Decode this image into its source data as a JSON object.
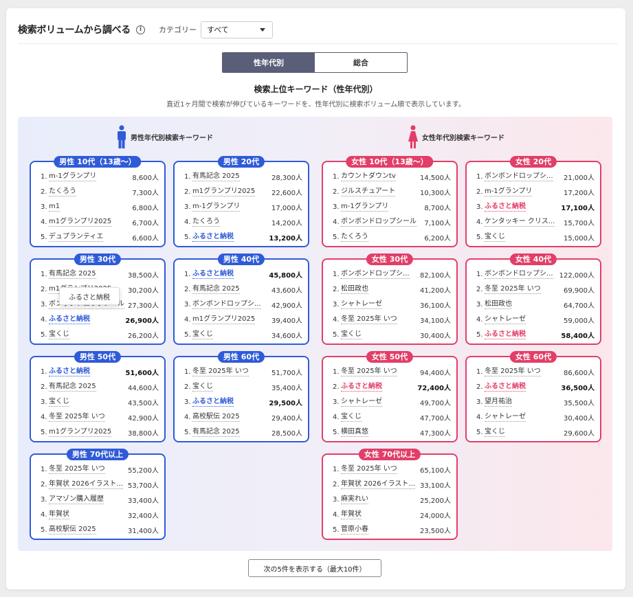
{
  "header": {
    "title": "検索ボリュームから調べる",
    "info_icon": "info-icon",
    "category_label": "カテゴリー",
    "category_value": "すべて"
  },
  "toggle": {
    "left": "性年代別",
    "right": "総合",
    "active": "left"
  },
  "section": {
    "title": "検索上位キーワード（性年代別）",
    "description": "直近1ヶ月間で検索が伸びているキーワードを、性年代別に検索ボリューム順で表示しています。"
  },
  "male_heading": "男性年代別検索キーワード",
  "female_heading": "女性年代別検索キーワード",
  "colors": {
    "male": "#2f5bd8",
    "female": "#e23e68",
    "toggle_active": "#5a5e78"
  },
  "groups": [
    {
      "gender": "m",
      "label": "男性 10代（13歳〜）",
      "items": [
        {
          "rank": "1.",
          "kw": "m-1グランプリ",
          "vol": "8,600人",
          "hl": false
        },
        {
          "rank": "2.",
          "kw": "たくろう",
          "vol": "7,300人",
          "hl": false
        },
        {
          "rank": "3.",
          "kw": "m1",
          "vol": "6,800人",
          "hl": false
        },
        {
          "rank": "4.",
          "kw": "m1グランプリ2025",
          "vol": "6,700人",
          "hl": false
        },
        {
          "rank": "5.",
          "kw": "デュプランティエ",
          "vol": "6,600人",
          "hl": false
        }
      ]
    },
    {
      "gender": "m",
      "label": "男性 20代",
      "items": [
        {
          "rank": "1.",
          "kw": "有馬記念 2025",
          "vol": "28,300人",
          "hl": false
        },
        {
          "rank": "2.",
          "kw": "m1グランプリ2025",
          "vol": "22,600人",
          "hl": false
        },
        {
          "rank": "3.",
          "kw": "m-1グランプリ",
          "vol": "17,000人",
          "hl": false
        },
        {
          "rank": "4.",
          "kw": "たくろう",
          "vol": "14,200人",
          "hl": false
        },
        {
          "rank": "5.",
          "kw": "ふるさと納税",
          "vol": "13,200人",
          "hl": true
        }
      ]
    },
    {
      "gender": "m",
      "label": "男性 30代",
      "items": [
        {
          "rank": "1.",
          "kw": "有馬記念 2025",
          "vol": "38,500人",
          "hl": false
        },
        {
          "rank": "2.",
          "kw": "m1グランプリ2025",
          "vol": "30,200人",
          "hl": false
        },
        {
          "rank": "3.",
          "kw": "ボンボンドロップシール",
          "vol": "27,300人",
          "hl": false
        },
        {
          "rank": "4.",
          "kw": "ふるさと納税",
          "vol": "26,900人",
          "hl": true
        },
        {
          "rank": "5.",
          "kw": "宝くじ",
          "vol": "26,200人",
          "hl": false
        }
      ]
    },
    {
      "gender": "m",
      "label": "男性 40代",
      "items": [
        {
          "rank": "1.",
          "kw": "ふるさと納税",
          "vol": "45,800人",
          "hl": true
        },
        {
          "rank": "2.",
          "kw": "有馬記念 2025",
          "vol": "43,600人",
          "hl": false
        },
        {
          "rank": "3.",
          "kw": "ボンボンドロップシ...",
          "vol": "42,900人",
          "hl": false
        },
        {
          "rank": "4.",
          "kw": "m1グランプリ2025",
          "vol": "39,400人",
          "hl": false
        },
        {
          "rank": "5.",
          "kw": "宝くじ",
          "vol": "34,600人",
          "hl": false
        }
      ]
    },
    {
      "gender": "m",
      "label": "男性 50代",
      "items": [
        {
          "rank": "1.",
          "kw": "ふるさと納税",
          "vol": "51,600人",
          "hl": true
        },
        {
          "rank": "2.",
          "kw": "有馬記念 2025",
          "vol": "44,600人",
          "hl": false
        },
        {
          "rank": "3.",
          "kw": "宝くじ",
          "vol": "43,500人",
          "hl": false
        },
        {
          "rank": "4.",
          "kw": "冬至 2025年 いつ",
          "vol": "42,900人",
          "hl": false
        },
        {
          "rank": "5.",
          "kw": "m1グランプリ2025",
          "vol": "38,800人",
          "hl": false
        }
      ]
    },
    {
      "gender": "m",
      "label": "男性 60代",
      "items": [
        {
          "rank": "1.",
          "kw": "冬至 2025年 いつ",
          "vol": "51,700人",
          "hl": false
        },
        {
          "rank": "2.",
          "kw": "宝くじ",
          "vol": "35,400人",
          "hl": false
        },
        {
          "rank": "3.",
          "kw": "ふるさと納税",
          "vol": "29,500人",
          "hl": true
        },
        {
          "rank": "4.",
          "kw": "高校駅伝 2025",
          "vol": "29,400人",
          "hl": false
        },
        {
          "rank": "5.",
          "kw": "有馬記念 2025",
          "vol": "28,500人",
          "hl": false
        }
      ]
    },
    {
      "gender": "m",
      "label": "男性 70代以上",
      "items": [
        {
          "rank": "1.",
          "kw": "冬至 2025年 いつ",
          "vol": "55,200人",
          "hl": false
        },
        {
          "rank": "2.",
          "kw": "年賀状 2026イラスト...",
          "vol": "53,700人",
          "hl": false
        },
        {
          "rank": "3.",
          "kw": "アマゾン購入履歴",
          "vol": "33,400人",
          "hl": false
        },
        {
          "rank": "4.",
          "kw": "年賀状",
          "vol": "32,400人",
          "hl": false
        },
        {
          "rank": "5.",
          "kw": "高校駅伝 2025",
          "vol": "31,400人",
          "hl": false
        }
      ]
    },
    {
      "gender": "f",
      "label": "女性 10代（13歳〜）",
      "items": [
        {
          "rank": "1.",
          "kw": "カウントダウンtv",
          "vol": "14,500人",
          "hl": false
        },
        {
          "rank": "2.",
          "kw": "ジルスチュアート",
          "vol": "10,300人",
          "hl": false
        },
        {
          "rank": "3.",
          "kw": "m-1グランプリ",
          "vol": "8,700人",
          "hl": false
        },
        {
          "rank": "4.",
          "kw": "ボンボンドロップシール",
          "vol": "7,100人",
          "hl": false
        },
        {
          "rank": "5.",
          "kw": "たくろう",
          "vol": "6,200人",
          "hl": false
        }
      ]
    },
    {
      "gender": "f",
      "label": "女性 20代",
      "items": [
        {
          "rank": "1.",
          "kw": "ボンボンドロップシ...",
          "vol": "21,000人",
          "hl": false
        },
        {
          "rank": "2.",
          "kw": "m-1グランプリ",
          "vol": "17,200人",
          "hl": false
        },
        {
          "rank": "3.",
          "kw": "ふるさと納税",
          "vol": "17,100人",
          "hl": true
        },
        {
          "rank": "4.",
          "kw": "ケンタッキー クリス...",
          "vol": "15,700人",
          "hl": false
        },
        {
          "rank": "5.",
          "kw": "宝くじ",
          "vol": "15,000人",
          "hl": false
        }
      ]
    },
    {
      "gender": "f",
      "label": "女性 30代",
      "items": [
        {
          "rank": "1.",
          "kw": "ボンボンドロップシ...",
          "vol": "82,100人",
          "hl": false
        },
        {
          "rank": "2.",
          "kw": "松田政也",
          "vol": "41,200人",
          "hl": false
        },
        {
          "rank": "3.",
          "kw": "シャトレーゼ",
          "vol": "36,100人",
          "hl": false
        },
        {
          "rank": "4.",
          "kw": "冬至 2025年 いつ",
          "vol": "34,100人",
          "hl": false
        },
        {
          "rank": "5.",
          "kw": "宝くじ",
          "vol": "30,400人",
          "hl": false
        }
      ]
    },
    {
      "gender": "f",
      "label": "女性 40代",
      "items": [
        {
          "rank": "1.",
          "kw": "ボンボンドロップシ...",
          "vol": "122,000人",
          "hl": false
        },
        {
          "rank": "2.",
          "kw": "冬至 2025年 いつ",
          "vol": "69,900人",
          "hl": false
        },
        {
          "rank": "3.",
          "kw": "松田政也",
          "vol": "64,700人",
          "hl": false
        },
        {
          "rank": "4.",
          "kw": "シャトレーゼ",
          "vol": "59,000人",
          "hl": false
        },
        {
          "rank": "5.",
          "kw": "ふるさと納税",
          "vol": "58,400人",
          "hl": true
        }
      ]
    },
    {
      "gender": "f",
      "label": "女性 50代",
      "items": [
        {
          "rank": "1.",
          "kw": "冬至 2025年 いつ",
          "vol": "94,400人",
          "hl": false
        },
        {
          "rank": "2.",
          "kw": "ふるさと納税",
          "vol": "72,400人",
          "hl": true
        },
        {
          "rank": "3.",
          "kw": "シャトレーゼ",
          "vol": "49,700人",
          "hl": false
        },
        {
          "rank": "4.",
          "kw": "宝くじ",
          "vol": "47,700人",
          "hl": false
        },
        {
          "rank": "5.",
          "kw": "横田真悠",
          "vol": "47,300人",
          "hl": false
        }
      ]
    },
    {
      "gender": "f",
      "label": "女性 60代",
      "items": [
        {
          "rank": "1.",
          "kw": "冬至 2025年 いつ",
          "vol": "86,600人",
          "hl": false
        },
        {
          "rank": "2.",
          "kw": "ふるさと納税",
          "vol": "36,500人",
          "hl": true
        },
        {
          "rank": "3.",
          "kw": "望月祐治",
          "vol": "35,500人",
          "hl": false
        },
        {
          "rank": "4.",
          "kw": "シャトレーゼ",
          "vol": "30,400人",
          "hl": false
        },
        {
          "rank": "5.",
          "kw": "宝くじ",
          "vol": "29,600人",
          "hl": false
        }
      ]
    },
    {
      "gender": "f",
      "label": "女性 70代以上",
      "items": [
        {
          "rank": "1.",
          "kw": "冬至 2025年 いつ",
          "vol": "65,100人",
          "hl": false
        },
        {
          "rank": "2.",
          "kw": "年賀状 2026イラスト...",
          "vol": "33,100人",
          "hl": false
        },
        {
          "rank": "3.",
          "kw": "麻実れい",
          "vol": "25,200人",
          "hl": false
        },
        {
          "rank": "4.",
          "kw": "年賀状",
          "vol": "24,000人",
          "hl": false
        },
        {
          "rank": "5.",
          "kw": "菅原小春",
          "vol": "23,500人",
          "hl": false
        }
      ]
    }
  ],
  "tooltip": "ふるさと納税",
  "more_button": "次の5件を表示する（最大10件）"
}
